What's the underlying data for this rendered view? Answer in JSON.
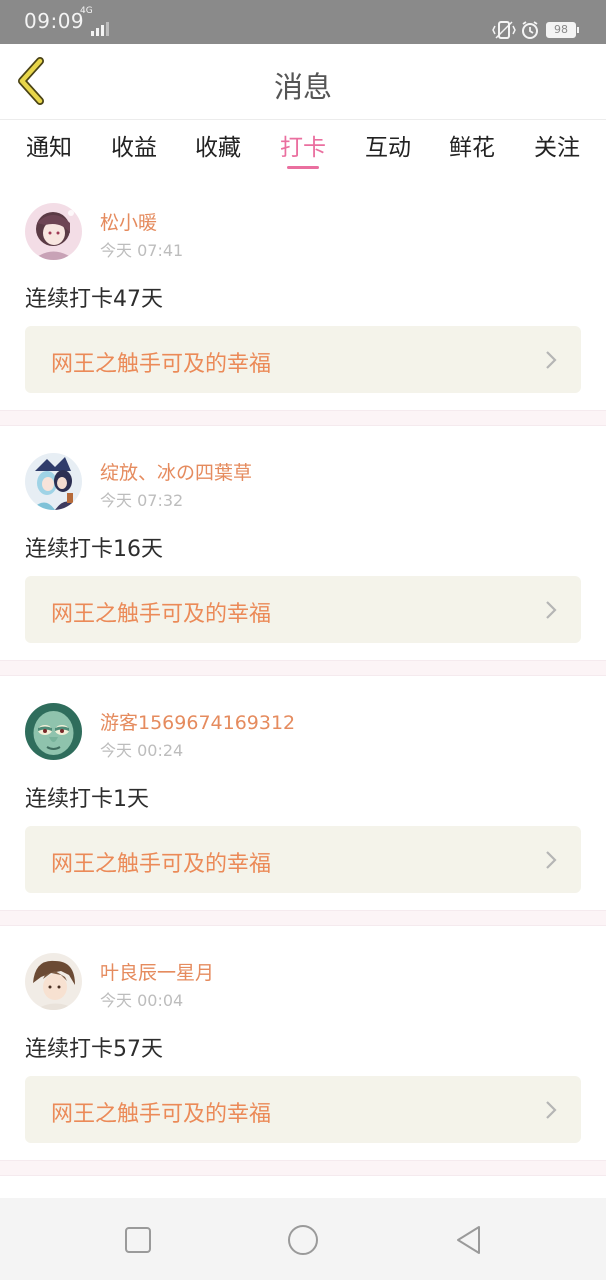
{
  "status_bar": {
    "time": "09:09",
    "network": "4G",
    "battery": "98"
  },
  "header": {
    "title": "消息",
    "back_icon": "chevron-left-icon",
    "accent_color": "#e8d64a"
  },
  "tabs": [
    {
      "label": "通知",
      "active": false
    },
    {
      "label": "收益",
      "active": false
    },
    {
      "label": "收藏",
      "active": false
    },
    {
      "label": "打卡",
      "active": true
    },
    {
      "label": "互动",
      "active": false
    },
    {
      "label": "鲜花",
      "active": false
    },
    {
      "label": "关注",
      "active": false
    }
  ],
  "colors": {
    "active_tab": "#ea6f9f",
    "username": "#e58b5e",
    "book_title": "#eb8a58",
    "book_bg": "#f4f3ea"
  },
  "messages": [
    {
      "username": "松小暖",
      "time": "今天 07:41",
      "text": "连续打卡47天",
      "book": "网王之触手可及的幸福"
    },
    {
      "username": "绽放、冰の四葉草",
      "time": "今天 07:32",
      "text": "连续打卡16天",
      "book": "网王之触手可及的幸福"
    },
    {
      "username": "游客1569674169312",
      "time": "今天 00:24",
      "text": "连续打卡1天",
      "book": "网王之触手可及的幸福"
    },
    {
      "username": "叶良辰一星月",
      "time": "今天 00:04",
      "text": "连续打卡57天",
      "book": "网王之触手可及的幸福"
    }
  ],
  "system_nav": {
    "recent_icon": "square-icon",
    "home_icon": "circle-icon",
    "back_icon": "triangle-back-icon"
  }
}
